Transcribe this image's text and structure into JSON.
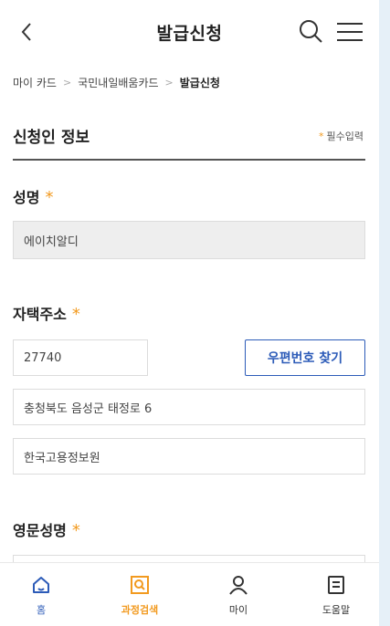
{
  "header": {
    "title": "발급신청",
    "back_icon": "chevron-left-icon",
    "search_icon": "search-icon",
    "menu_icon": "hamburger-menu-icon"
  },
  "breadcrumb": [
    "마이 카드",
    "국민내일배움카드",
    "발급신청"
  ],
  "section": {
    "title": "신청인 정보",
    "required_note": "필수입력",
    "star": "*"
  },
  "fields": {
    "name": {
      "label": "성명",
      "value": "에이치알디"
    },
    "address": {
      "label": "자택주소",
      "zipcode": "27740",
      "zip_button": "우편번호 찾기",
      "address1": "충청북도 음성군 태정로 6",
      "address2": "한국고용정보원"
    },
    "english_name": {
      "label": "영문성명",
      "value": ""
    }
  },
  "bottom_nav": [
    {
      "label": "홈",
      "icon": "home-icon"
    },
    {
      "label": "과정검색",
      "icon": "course-search-icon"
    },
    {
      "label": "마이",
      "icon": "person-icon"
    },
    {
      "label": "도움말",
      "icon": "help-document-icon"
    }
  ],
  "colors": {
    "accent": "#f29a1f",
    "primary": "#2c5bb8",
    "readonly_bg": "#eeeeee"
  }
}
